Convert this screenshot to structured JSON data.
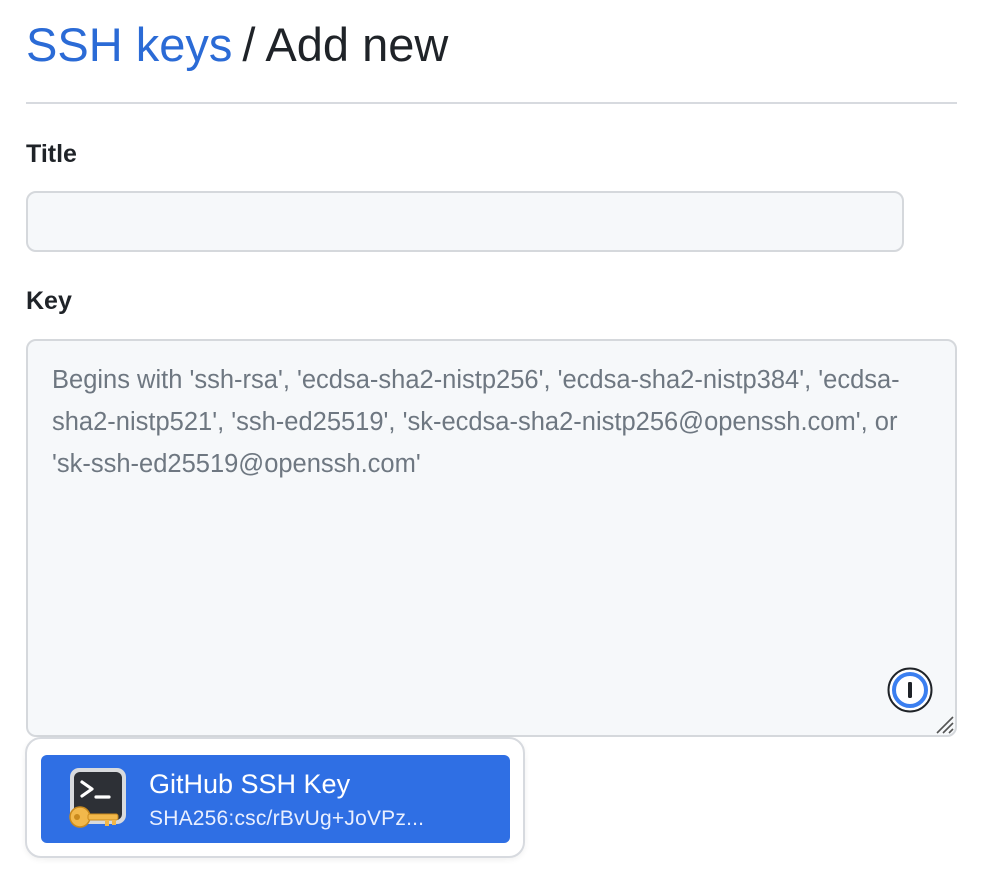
{
  "breadcrumb": {
    "link_label": "SSH keys",
    "separator": "/",
    "current": "Add new"
  },
  "form": {
    "title_label": "Title",
    "title_value": "",
    "key_label": "Key",
    "key_value": "",
    "key_placeholder": "Begins with 'ssh-rsa', 'ecdsa-sha2-nistp256', 'ecdsa-sha2-nistp384', 'ecdsa-sha2-nistp521', 'ssh-ed25519', 'sk-ecdsa-sha2-nistp256@openssh.com', or 'sk-ssh-ed25519@openssh.com'"
  },
  "password_manager": {
    "icon": "onepassword-icon",
    "suggestion": {
      "icon": "ssh-key-terminal-icon",
      "name": "GitHub SSH Key",
      "fingerprint": "SHA256:csc/rBvUg+JoVPz..."
    }
  },
  "colors": {
    "link": "#2b6bd6",
    "suggestion_background": "#2f6fe4",
    "input_background": "#f6f8fa"
  }
}
